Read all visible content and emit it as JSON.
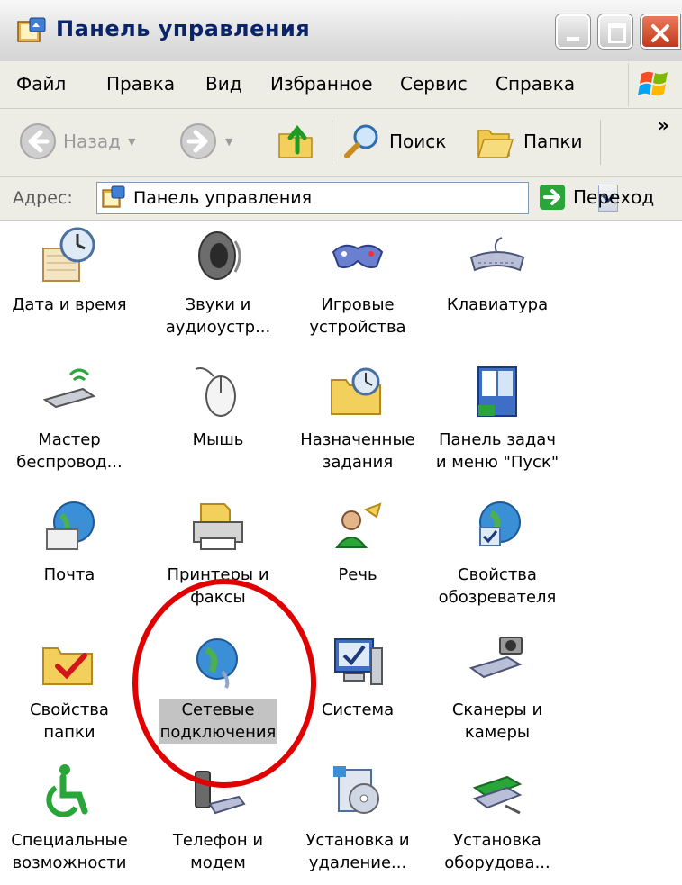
{
  "window": {
    "title": "Панель управления",
    "icon": "control-panel-icon",
    "controls": [
      "minimize",
      "maximize",
      "close"
    ]
  },
  "menubar": {
    "items": [
      "Файл",
      "Правка",
      "Вид",
      "Избранное",
      "Сервис",
      "Справка"
    ]
  },
  "toolbar": {
    "back_label": "Назад",
    "search_label": "Поиск",
    "folders_label": "Папки",
    "more": "»"
  },
  "address": {
    "label": "Адрес:",
    "value": "Панель управления",
    "go_label": "Переход"
  },
  "items": [
    {
      "label": "Дата и время",
      "icon": "date-time-icon"
    },
    {
      "label": "Звуки и\nаудиоустр...",
      "icon": "sounds-icon"
    },
    {
      "label": "Игровые\nустройства",
      "icon": "game-controllers-icon"
    },
    {
      "label": "Клавиатура",
      "icon": "keyboard-icon"
    },
    {
      "label": "Мастер\nбеспровод...",
      "icon": "wireless-wizard-icon"
    },
    {
      "label": "Мышь",
      "icon": "mouse-icon"
    },
    {
      "label": "Назначенные\nзадания",
      "icon": "scheduled-tasks-icon"
    },
    {
      "label": "Панель задач\nи меню \"Пуск\"",
      "icon": "taskbar-start-menu-icon"
    },
    {
      "label": "Почта",
      "icon": "mail-icon"
    },
    {
      "label": "Принтеры и\nфаксы",
      "icon": "printers-faxes-icon"
    },
    {
      "label": "Речь",
      "icon": "speech-icon"
    },
    {
      "label": "Свойства\nобозревателя",
      "icon": "internet-options-icon"
    },
    {
      "label": "Свойства\nпапки",
      "icon": "folder-options-icon"
    },
    {
      "label": "Сетевые\nподключения",
      "icon": "network-connections-icon",
      "selected": true
    },
    {
      "label": "Система",
      "icon": "system-icon"
    },
    {
      "label": "Сканеры и\nкамеры",
      "icon": "scanners-cameras-icon"
    },
    {
      "label": "Специальные\nвозможности",
      "icon": "accessibility-icon"
    },
    {
      "label": "Телефон и\nмодем",
      "icon": "phone-modem-icon"
    },
    {
      "label": "Установка и\nудаление...",
      "icon": "add-remove-programs-icon"
    },
    {
      "label": "Установка\nоборудова...",
      "icon": "add-hardware-icon"
    }
  ],
  "colors": {
    "title_text": "#0a246a",
    "highlight_circle": "#e10000",
    "selection": "#c3c3c3"
  }
}
